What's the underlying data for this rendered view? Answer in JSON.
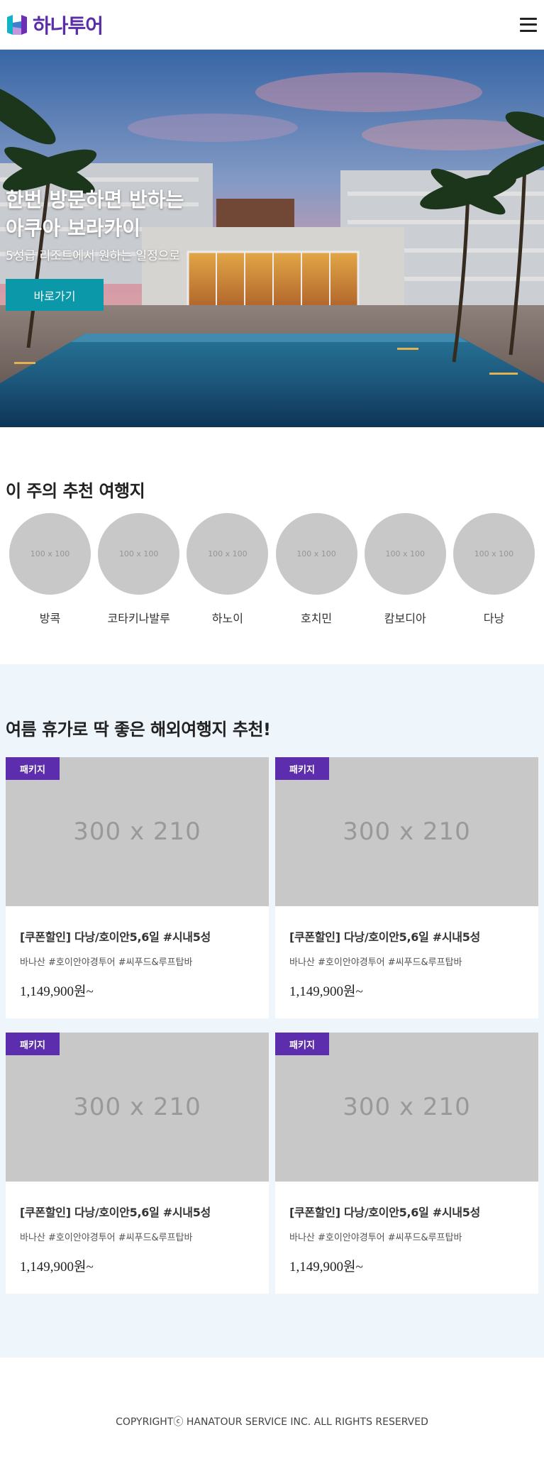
{
  "header": {
    "logo_text": "하나투어",
    "logo_icon": "hanatour-logo-icon",
    "menu_icon": "hamburger-menu-icon"
  },
  "hero": {
    "title_line1": "한번 방문하면 반하는",
    "title_line2": "아쿠아 보라카이",
    "subtitle": "5성급 리조트에서 원하는 일정으로",
    "button_label": "바로가기",
    "button_color": "#0b98a9"
  },
  "weekly": {
    "title": "이 주의 추천 여행지",
    "placeholder": "100 x 100",
    "destinations": [
      {
        "label": "방콕"
      },
      {
        "label": "코타키나발루"
      },
      {
        "label": "하노이"
      },
      {
        "label": "호치민"
      },
      {
        "label": "캄보디아"
      },
      {
        "label": "다낭"
      }
    ]
  },
  "summer": {
    "title": "여름 휴가로 딱 좋은 해외여행지 추천!",
    "background": "#eef6fc",
    "badge_color": "#5c2dac",
    "cards": [
      {
        "badge": "패키지",
        "placeholder": "300 x 210",
        "title": "[쿠폰할인] 다낭/호이안5,6일 #시내5성",
        "tags": "바나산 #호이안야경투어 #씨푸드&루프탑바",
        "price": "1,149,900원~"
      },
      {
        "badge": "패키지",
        "placeholder": "300 x 210",
        "title": "[쿠폰할인] 다낭/호이안5,6일 #시내5성",
        "tags": "바나산 #호이안야경투어 #씨푸드&루프탑바",
        "price": "1,149,900원~"
      },
      {
        "badge": "패키지",
        "placeholder": "300 x 210",
        "title": "[쿠폰할인] 다낭/호이안5,6일 #시내5성",
        "tags": "바나산 #호이안야경투어 #씨푸드&루프탑바",
        "price": "1,149,900원~"
      },
      {
        "badge": "패키지",
        "placeholder": "300 x 210",
        "title": "[쿠폰할인] 다낭/호이안5,6일 #시내5성",
        "tags": "바나산 #호이안야경투어 #씨푸드&루프탑바",
        "price": "1,149,900원~"
      }
    ]
  },
  "footer": {
    "copyright": "COPYRIGHTⓒ HANATOUR SERVICE INC. ALL RIGHTS RESERVED"
  }
}
